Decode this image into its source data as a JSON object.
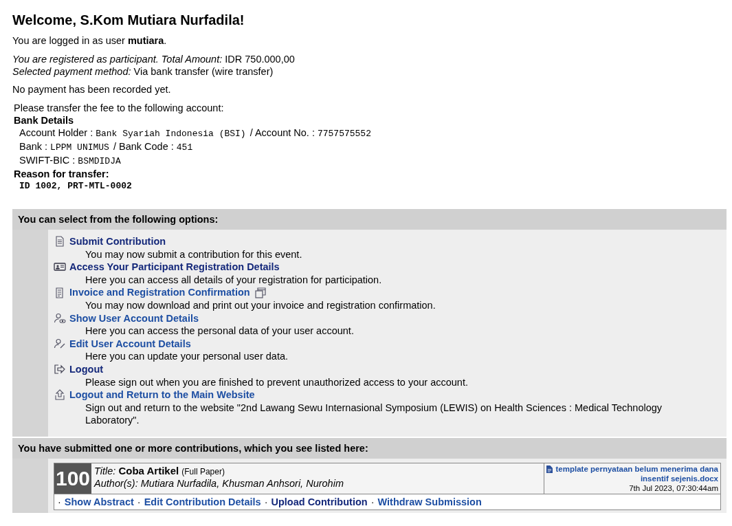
{
  "heading": "Welcome, S.Kom Mutiara Nurfadila!",
  "login_line": "You are logged in as user **mutiara**.",
  "registration_lines": [
    "*You are registered as participant. Total Amount:* IDR 750.000,00",
    "*Selected payment method:* Via bank transfer (wire transfer)"
  ],
  "payment_status": "No payment has been recorded yet.",
  "transfer": {
    "intro": "Please transfer the fee to the following account:",
    "bank_heading": "Bank Details",
    "lines": [
      [
        {
          "label": "Account Holder :",
          "value": "Bank Syariah Indonesia (BSI)"
        },
        {
          "label": "/ Account No. :",
          "value": "7757575552"
        }
      ],
      [
        {
          "label": "Bank :",
          "value": "LPPM UNIMUS"
        },
        {
          "label": "/ Bank Code :",
          "value": "451"
        }
      ],
      [
        {
          "label": "SWIFT-BIC :",
          "value": "BSMDIDJA"
        }
      ]
    ],
    "reason_heading": "Reason for transfer:",
    "reason": "ID 1002, PRT-MTL-0002"
  },
  "options": {
    "title": "You can select from the following options:",
    "items": [
      {
        "label": "Submit Contribution",
        "visited": false,
        "description": "You may now submit a contribution for this event.",
        "popup": false
      },
      {
        "label": "Access Your Participant Registration Details",
        "visited": false,
        "description": "Here you can access all details of your registration for participation.",
        "popup": false
      },
      {
        "label": "Invoice and Registration Confirmation",
        "visited": true,
        "description": "You may now download and print out your invoice and registration confirmation.",
        "popup": true
      },
      {
        "label": "Show User Account Details",
        "visited": true,
        "description": "Here you can access the personal data of your user account.",
        "popup": false
      },
      {
        "label": "Edit User Account Details",
        "visited": true,
        "description": "Here you can update your personal user data.",
        "popup": false
      },
      {
        "label": "Logout",
        "visited": false,
        "description": "Please sign out when you are finished to prevent unauthorized access to your account.",
        "popup": false
      },
      {
        "label": "Logout and Return to the Main Website",
        "visited": true,
        "description": "Sign out and return to the website \"2nd Lawang Sewu Internasional Symposium (LEWIS) on Health Sciences : Medical Technology Laboratory\".",
        "popup": false
      }
    ]
  },
  "contributions": {
    "title": "You have submitted one or more contributions, which you see listed here:",
    "items": [
      {
        "number": "100",
        "title_label": "Title:",
        "title": "Coba Artikel",
        "type": "(Full Paper)",
        "authors": "Author(s): Mutiara Nurfadila, Khusman Anhsori, Nurohim",
        "file": "template pernyataan belum menerima dana insentif sejenis.docx",
        "date": "7th Jul 2023, 07:30:44am",
        "separator": "·",
        "actions": [
          {
            "label": "Show Abstract",
            "visited": true
          },
          {
            "label": "Edit Contribution Details",
            "visited": true
          },
          {
            "label": "Upload Contribution",
            "visited": false
          },
          {
            "label": "Withdraw Submission",
            "visited": true
          }
        ]
      }
    ]
  }
}
